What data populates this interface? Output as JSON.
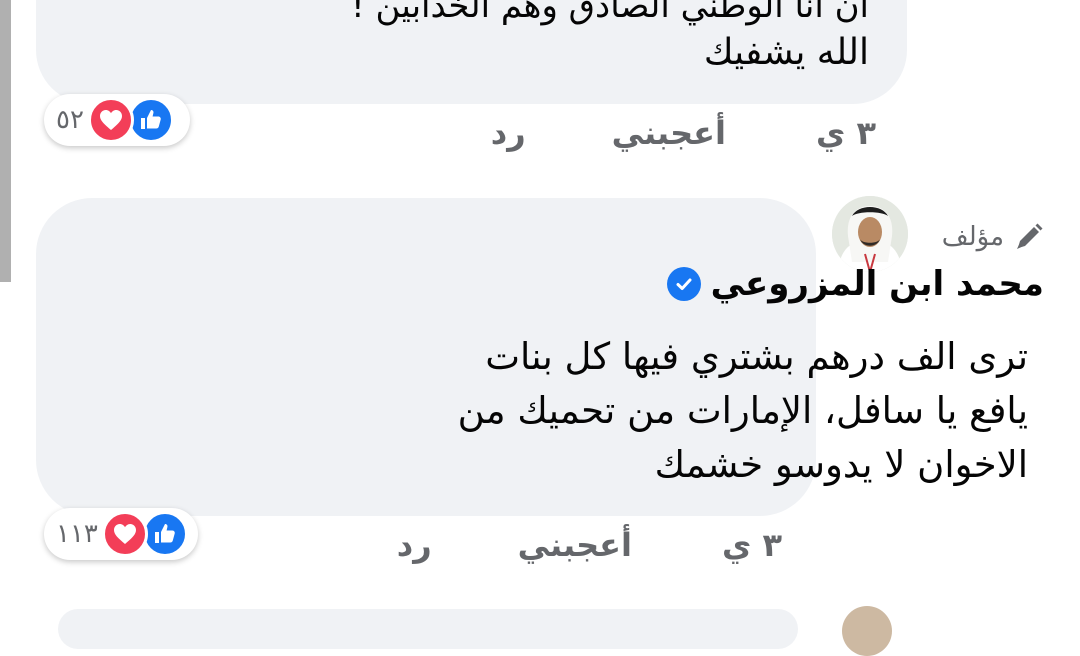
{
  "comments": [
    {
      "cut_line": "أن أنا الوطني الصادق وهم الخدابين !",
      "last_line": "الله يشفيك",
      "time": "٣ ي",
      "like_label": "أعجبني",
      "reply_label": "رد",
      "reactions_count": "٥٢"
    },
    {
      "author_badge": "مؤلف",
      "author_name": "محمد ابن  المزروعي",
      "text_lines": [
        "ترى الف درهم بشتري فيها كل بنات",
        "يافع يا سافل، الإمارات من تحميك من",
        "الاخوان لا يدوسو خشمك"
      ],
      "time": "٣ ي",
      "like_label": "أعجبني",
      "reply_label": "رد",
      "reactions_count": "١١٣"
    }
  ],
  "icons": {
    "like": "like-icon",
    "love": "heart-icon",
    "author": "pencil-icon",
    "verified": "verified-check-icon"
  },
  "colors": {
    "bubble": "#f0f2f5",
    "like_blue": "#1877f2",
    "love_red": "#f33e58",
    "meta_gray": "#65676b"
  }
}
